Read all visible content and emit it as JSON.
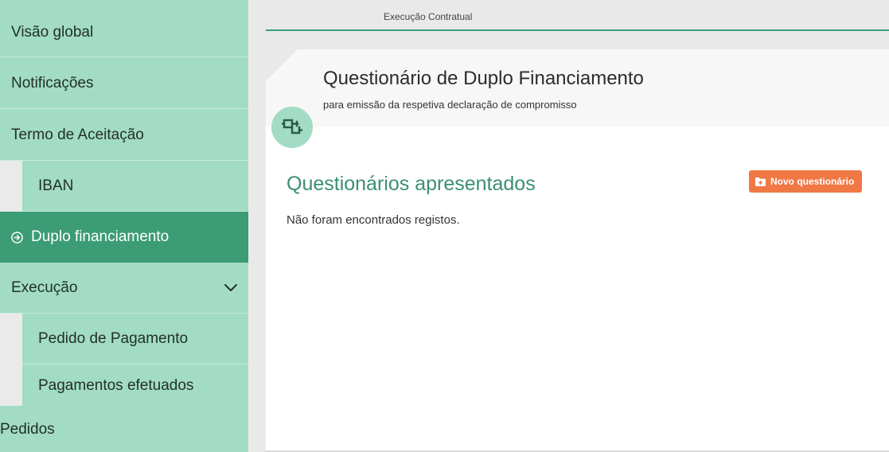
{
  "sidebar": {
    "items": [
      {
        "label": "Visão global"
      },
      {
        "label": "Notificações"
      },
      {
        "label": "Termo de Aceitação"
      },
      {
        "label": "IBAN"
      },
      {
        "label": "Duplo financiamento"
      },
      {
        "label": "Execução"
      },
      {
        "label": "Pedido de Pagamento"
      },
      {
        "label": "Pagamentos efetuados"
      },
      {
        "label": "Pedidos"
      }
    ]
  },
  "main": {
    "tab_title": "Execução Contratual",
    "header": {
      "title": "Questionário de Duplo Financiamento",
      "subtitle": "para emissão da respetiva declaração de compromisso"
    },
    "section": {
      "title": "Questionários apresentados",
      "empty_message": "Não foram encontrados registos.",
      "new_button_label": "Novo questionário"
    }
  },
  "colors": {
    "sidebar_bg": "#a2dcc4",
    "active_bg": "#3c9c76",
    "accent_green": "#3c8f6f",
    "button_orange": "#f07845"
  },
  "icons": {
    "active_item": "arrow-circle-right-icon",
    "execucao": "chevron-down-icon",
    "header": "workflow-icon",
    "new_button": "folder-plus-icon"
  }
}
